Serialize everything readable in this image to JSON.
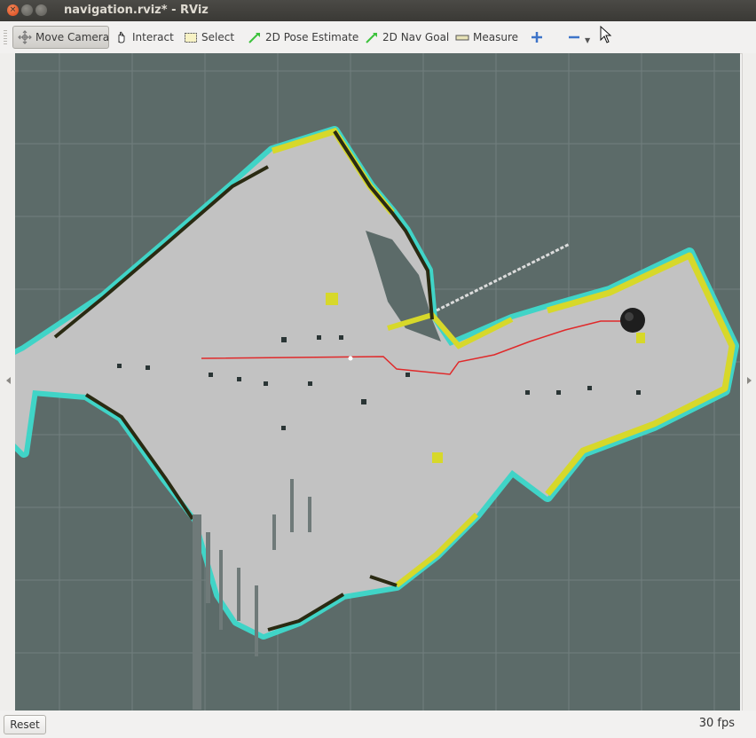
{
  "window": {
    "title": "navigation.rviz* - RViz",
    "buttons": [
      "close",
      "minimize",
      "maximize"
    ]
  },
  "toolbar": {
    "tools": [
      {
        "label": "Move Camera",
        "icon": "move-camera-icon",
        "active": true
      },
      {
        "label": "Interact",
        "icon": "hand-icon",
        "active": false
      },
      {
        "label": "Select",
        "icon": "select-box-icon",
        "active": false
      },
      {
        "label": "2D Pose Estimate",
        "icon": "green-arrow-icon",
        "active": false
      },
      {
        "label": "2D Nav Goal",
        "icon": "green-arrow-icon",
        "active": false
      },
      {
        "label": "Measure",
        "icon": "ruler-icon",
        "active": false
      }
    ],
    "add_tool_icon": "plus-icon",
    "remove_tool_icon": "minus-icon"
  },
  "viewport": {
    "content": "occupancy-grid map with costmap inflation, planned path and robot",
    "colors": {
      "background": "#5c6b69",
      "free_space": "#c2c2c2",
      "obstacle": "#2a2a12",
      "inflation_yellow": "#d7d82a",
      "inflation_cyan": "#3de0d2",
      "path": "#e0292a",
      "grid": "#7f8b8a"
    }
  },
  "status": {
    "reset_label": "Reset",
    "fps": "30 fps"
  }
}
